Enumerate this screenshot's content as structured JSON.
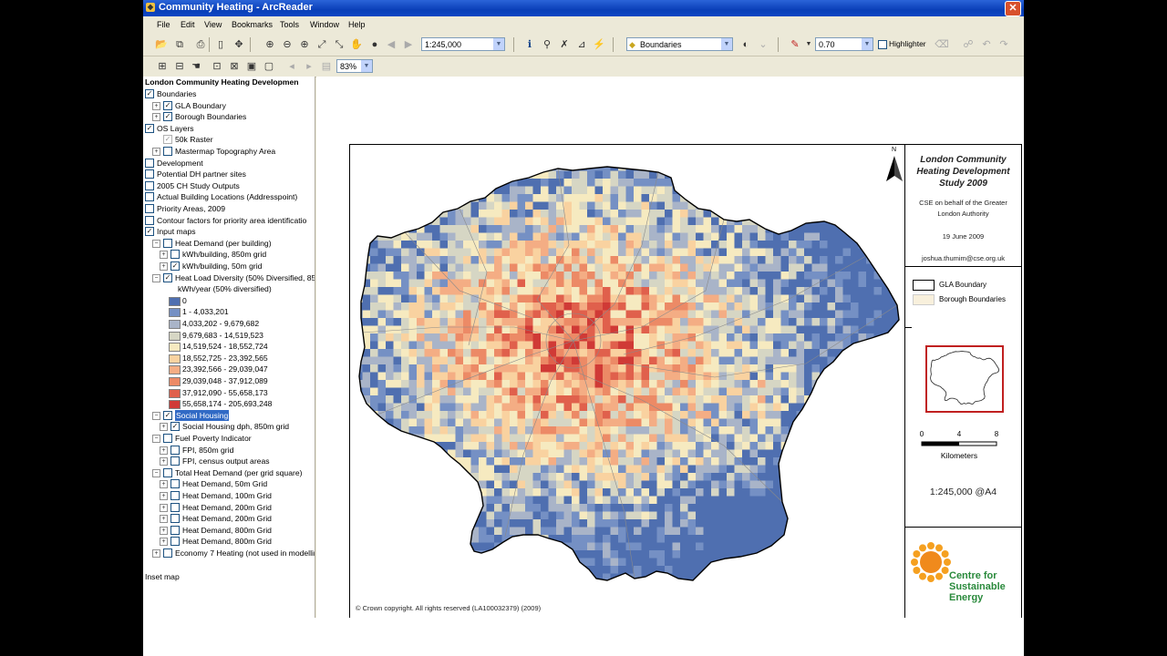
{
  "window": {
    "title": "Community Heating - ArcReader",
    "close": "✕"
  },
  "menu": [
    "File",
    "Edit",
    "View",
    "Bookmarks",
    "Tools",
    "Window",
    "Help"
  ],
  "toolbar": {
    "scale": "1:245,000",
    "layer": "Boundaries",
    "transparency": "0.70",
    "highlighter": "Highlighter",
    "zoom": "83%"
  },
  "toc": {
    "title": "London Community Heating Developmen",
    "items": [
      {
        "label": "Boundaries",
        "indent": 0,
        "checked": true,
        "expander": false
      },
      {
        "label": "GLA Boundary",
        "indent": 1,
        "checked": true,
        "expander": true
      },
      {
        "label": "Borough Boundaries",
        "indent": 1,
        "checked": true,
        "expander": true
      },
      {
        "label": "OS Layers",
        "indent": 0,
        "checked": true,
        "expander": false
      },
      {
        "label": "50k Raster",
        "indent": 1,
        "checked": true,
        "expander": false,
        "gray": true
      },
      {
        "label": "Mastermap Topography Area",
        "indent": 1,
        "checked": false,
        "expander": true
      },
      {
        "label": "Development",
        "indent": 0,
        "checked": false,
        "expander": false
      },
      {
        "label": "Potential DH partner sites",
        "indent": 0,
        "checked": false,
        "expander": false
      },
      {
        "label": "2005 CH Study Outputs",
        "indent": 0,
        "checked": false,
        "expander": false
      },
      {
        "label": "Actual Building Locations (Addresspoint)",
        "indent": 0,
        "checked": false,
        "expander": false
      },
      {
        "label": "Priority Areas, 2009",
        "indent": 0,
        "checked": false,
        "expander": false
      },
      {
        "label": "Contour factors for priority area identificatio",
        "indent": 0,
        "checked": false,
        "expander": false
      },
      {
        "label": "Input maps",
        "indent": 0,
        "checked": true,
        "expander": false
      },
      {
        "label": "Heat Demand (per building)",
        "indent": 1,
        "checked": false,
        "expander": false,
        "minus": true
      },
      {
        "label": "kWh/building, 850m grid",
        "indent": 2,
        "checked": false,
        "expander": true
      },
      {
        "label": "kWh/building, 50m grid",
        "indent": 2,
        "checked": true,
        "expander": true
      },
      {
        "label": "Heat Load Diversity (50% Diversified, 85",
        "indent": 1,
        "checked": true,
        "expander": false,
        "minus": true
      },
      {
        "label": "kWh/year (50% diversified)",
        "indent": 3,
        "checked": null,
        "expander": false
      }
    ],
    "legend": [
      {
        "label": "0",
        "color": "#4f6fb0"
      },
      {
        "label": "1 - 4,033,201",
        "color": "#7590c4"
      },
      {
        "label": "4,033,202 - 9,679,682",
        "color": "#a9b4c8"
      },
      {
        "label": "9,679,683 - 14,519,523",
        "color": "#d6d6c4"
      },
      {
        "label": "14,519,524 - 18,552,724",
        "color": "#f6eac0"
      },
      {
        "label": "18,552,725 - 23,392,565",
        "color": "#f9d2a0"
      },
      {
        "label": "23,392,566 - 29,039,047",
        "color": "#f4ad84"
      },
      {
        "label": "29,039,048 - 37,912,089",
        "color": "#ec8a66"
      },
      {
        "label": "37,912,090 - 55,658,173",
        "color": "#e0604c"
      },
      {
        "label": "55,658,174 - 205,693,248",
        "color": "#d03a36"
      }
    ],
    "items2": [
      {
        "label": "Social Housing",
        "indent": 1,
        "checked": true,
        "expander": false,
        "minus": true,
        "selected": true
      },
      {
        "label": "Social Housing dph, 850m grid",
        "indent": 2,
        "checked": true,
        "expander": true
      },
      {
        "label": "Fuel Poverty Indicator",
        "indent": 1,
        "checked": false,
        "expander": false,
        "minus": true
      },
      {
        "label": "FPI, 850m grid",
        "indent": 2,
        "checked": false,
        "expander": true
      },
      {
        "label": "FPI, census output areas",
        "indent": 2,
        "checked": false,
        "expander": true
      },
      {
        "label": "Total Heat Demand (per grid square)",
        "indent": 1,
        "checked": false,
        "expander": false,
        "minus": true
      },
      {
        "label": "Heat Demand, 50m Grid",
        "indent": 2,
        "checked": false,
        "expander": true
      },
      {
        "label": "Heat Demand, 100m Grid",
        "indent": 2,
        "checked": false,
        "expander": true
      },
      {
        "label": "Heat Demand, 200m Grid",
        "indent": 2,
        "checked": false,
        "expander": true
      },
      {
        "label": "Heat Demand, 200m Grid",
        "indent": 2,
        "checked": false,
        "expander": true
      },
      {
        "label": "Heat Demand, 800m Grid",
        "indent": 2,
        "checked": false,
        "expander": true
      },
      {
        "label": "Heat Demand, 800m Grid",
        "indent": 2,
        "checked": false,
        "expander": true
      },
      {
        "label": "Economy 7 Heating (not used in modellin",
        "indent": 1,
        "checked": false,
        "expander": true
      }
    ],
    "inset": "Inset map"
  },
  "map": {
    "title": "London Community Heating Development Study 2009",
    "subtitle": "CSE on behalf of the Greater London Authority",
    "date": "19 June 2009",
    "email": "joshua.thumim@cse.org.uk",
    "north": "N",
    "legend": [
      {
        "label": "GLA Boundary"
      },
      {
        "label": "Borough Boundaries"
      }
    ],
    "scale_ticks": [
      "0",
      "4",
      "8"
    ],
    "scale_unit": "Kilometers",
    "scale_text": "1:245,000 @A4",
    "copyright": "© Crown copyright. All rights reserved (LA100032379) (2009)",
    "logo_text": "Centre for Sustainable Energy"
  },
  "colors": {
    "title_bar": "#0a3fb8",
    "selection": "#316ac5",
    "logo_orange": "#f08a1c",
    "logo_green": "#2a8a3c"
  }
}
